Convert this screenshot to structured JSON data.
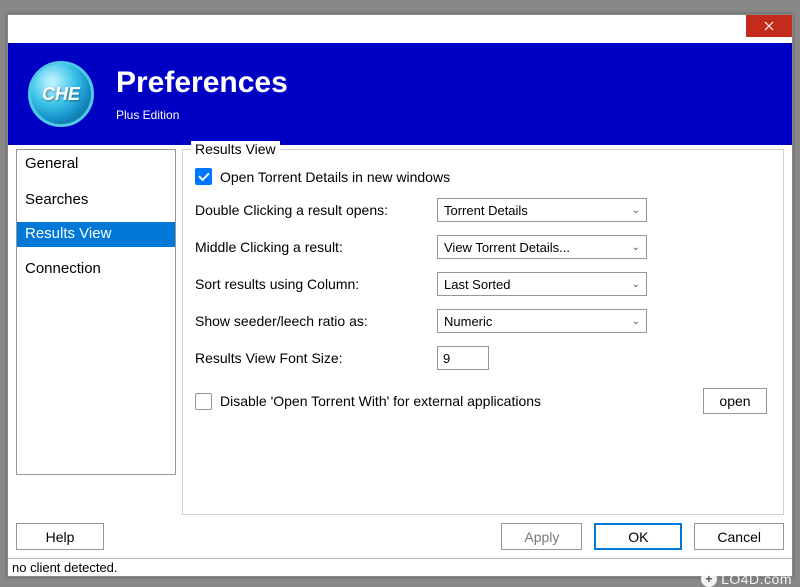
{
  "header": {
    "title": "Preferences",
    "subtitle": "Plus Edition",
    "logo_text": "CHE"
  },
  "sidebar": {
    "items": [
      {
        "label": "General",
        "selected": false
      },
      {
        "label": "Searches",
        "selected": false
      },
      {
        "label": "Results View",
        "selected": true
      },
      {
        "label": "Connection",
        "selected": false
      }
    ]
  },
  "content": {
    "group_title": "Results View",
    "open_in_new_windows": {
      "label": "Open Torrent Details in new windows",
      "checked": true
    },
    "double_click": {
      "label": "Double Clicking a result opens:",
      "value": "Torrent Details"
    },
    "middle_click": {
      "label": "Middle Clicking a result:",
      "value": "View Torrent Details..."
    },
    "sort_column": {
      "label": "Sort results using Column:",
      "value": "Last Sorted"
    },
    "ratio": {
      "label": "Show seeder/leech ratio as:",
      "value": "Numeric"
    },
    "font_size": {
      "label": "Results View Font Size:",
      "value": "9"
    },
    "disable_open_with": {
      "label": "Disable 'Open Torrent With' for external applications",
      "checked": false,
      "button": "open"
    }
  },
  "buttons": {
    "help": "Help",
    "apply": "Apply",
    "ok": "OK",
    "cancel": "Cancel"
  },
  "status": "no client detected.",
  "watermark": "LO4D.com"
}
